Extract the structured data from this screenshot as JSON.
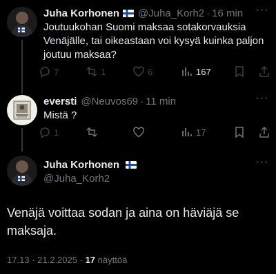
{
  "reply1": {
    "name": "Juha Korhonen",
    "flag": "finland-flag",
    "handle": "@Juha_Korh2",
    "separator": "·",
    "time": "16 min",
    "text": "Joutuukohan Suomi maksaa sotakorvauksia Venäjälle, tai oikeastaan voi kysyä kuinka paljon joutuu maksaa?",
    "actions": {
      "replies": "7",
      "reposts": "1",
      "likes": "6",
      "views": "167"
    }
  },
  "reply2": {
    "name": "eversti",
    "handle": "@Neuvos69",
    "separator": "·",
    "time": "11 min",
    "text": "Mistä ?",
    "actions": {
      "replies": "1",
      "reposts": "",
      "likes": "",
      "views": "17"
    }
  },
  "main_post": {
    "name": "Juha Korhonen",
    "flag": "finland-flag",
    "handle": "@Juha_Korh2",
    "text": "Venäjä voittaa sodan ja aina on häviäjä se maksaja.",
    "time": "17.13",
    "date": "21.2.2025",
    "meta_sep": "·",
    "views_count": "17",
    "views_label": "näyttöä"
  },
  "colors": {
    "background": "#000000",
    "text_primary": "#e7e9ea",
    "text_secondary": "#71767b",
    "thread_line": "#333639"
  }
}
